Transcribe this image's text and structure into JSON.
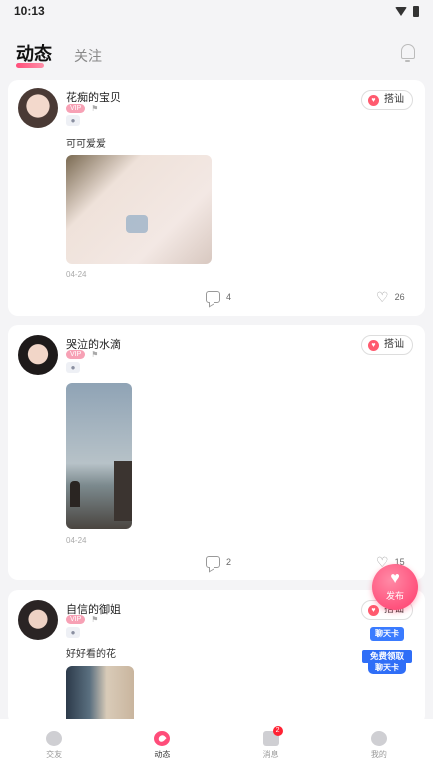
{
  "status_bar": {
    "time": "10:13"
  },
  "header": {
    "tab_active": "动态",
    "tab_follow": "关注"
  },
  "chat_label": "搭讪",
  "vip_label": "VIP",
  "posts": [
    {
      "name": "花痴的宝贝",
      "text": "可可爱爱",
      "date": "04-24",
      "comments": "4",
      "likes": "26"
    },
    {
      "name": "哭泣的水滴",
      "text": "",
      "date": "04-24",
      "comments": "2",
      "likes": "15"
    },
    {
      "name": "自信的御姐",
      "text": "好好看的花",
      "date": "",
      "comments": "",
      "likes": ""
    }
  ],
  "fab": {
    "label": "发布"
  },
  "promo": {
    "top": "聊天卡",
    "mid": "免费领取",
    "bottom": "聊天卡"
  },
  "tabbar": {
    "items": [
      {
        "label": "交友",
        "icon": "friends-icon"
      },
      {
        "label": "动态",
        "icon": "feed-icon"
      },
      {
        "label": "消息",
        "icon": "message-icon",
        "badge": "2"
      },
      {
        "label": "我的",
        "icon": "profile-icon"
      }
    ]
  },
  "colors": {
    "accent": "#ff4d7a",
    "promo_blue": "#2f6ef7"
  }
}
